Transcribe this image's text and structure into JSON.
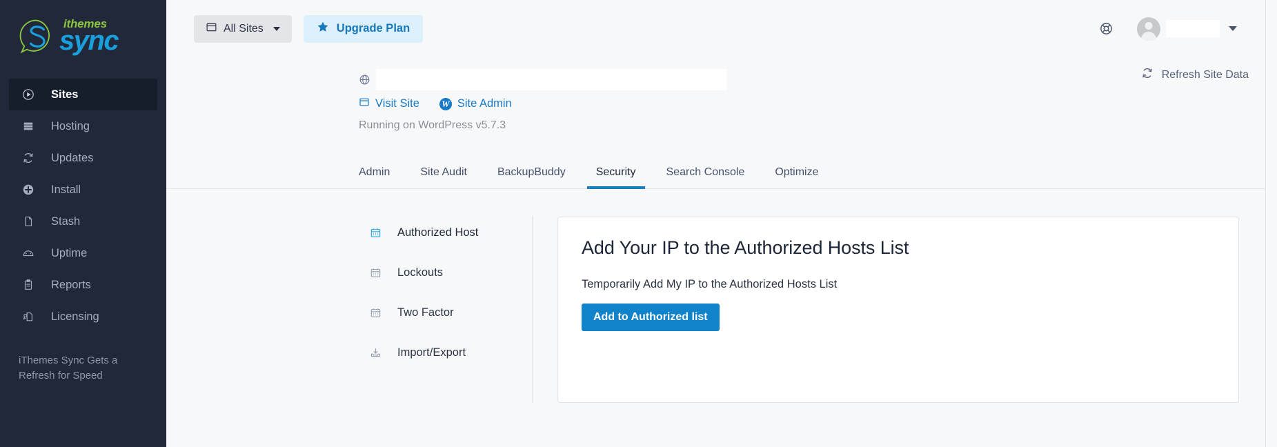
{
  "brand": {
    "name_top": "ithemes",
    "name_bottom": "sync",
    "green": "#8cc63e",
    "blue": "#1a9fdc"
  },
  "sidebar": {
    "items": [
      {
        "label": "Sites",
        "icon": "play-circle-icon",
        "active": true
      },
      {
        "label": "Hosting",
        "icon": "server-icon",
        "active": false
      },
      {
        "label": "Updates",
        "icon": "refresh-icon",
        "active": false
      },
      {
        "label": "Install",
        "icon": "plus-circle-icon",
        "active": false
      },
      {
        "label": "Stash",
        "icon": "file-icon",
        "active": false
      },
      {
        "label": "Uptime",
        "icon": "gauge-icon",
        "active": false
      },
      {
        "label": "Reports",
        "icon": "clipboard-icon",
        "active": false
      },
      {
        "label": "Licensing",
        "icon": "license-tag-icon",
        "active": false
      }
    ],
    "note": "iThemes Sync Gets a Refresh for Speed"
  },
  "topbar": {
    "sites_selector": "All Sites",
    "sites_icon": "window-icon",
    "upgrade_label": "Upgrade Plan",
    "upgrade_icon": "star-icon",
    "help_icon": "lifebuoy-icon",
    "avatar_icon": "avatar",
    "user_name": "",
    "user_caret_icon": "chevron-down-icon"
  },
  "site_header": {
    "globe_icon": "globe-icon",
    "site_name": "",
    "visit_site": "Visit Site",
    "visit_icon": "window-icon",
    "site_admin": "Site Admin",
    "site_admin_icon": "wordpress-icon",
    "version_text": "Running on WordPress v5.7.3",
    "refresh_label": "Refresh Site Data",
    "refresh_icon": "refresh-icon"
  },
  "tabs": [
    {
      "label": "Admin",
      "active": false
    },
    {
      "label": "Site Audit",
      "active": false
    },
    {
      "label": "BackupBuddy",
      "active": false
    },
    {
      "label": "Security",
      "active": true
    },
    {
      "label": "Search Console",
      "active": false
    },
    {
      "label": "Optimize",
      "active": false
    }
  ],
  "subnav": [
    {
      "label": "Authorized Host",
      "icon": "calendar-icon",
      "active": true
    },
    {
      "label": "Lockouts",
      "icon": "calendar-icon",
      "active": false
    },
    {
      "label": "Two Factor",
      "icon": "calendar-icon",
      "active": false
    },
    {
      "label": "Import/Export",
      "icon": "import-export-icon",
      "active": false
    }
  ],
  "card": {
    "title": "Add Your IP to the Authorized Hosts List",
    "description": "Temporarily Add My IP to the Authorized Hosts List",
    "button_label": "Add to Authorized list",
    "button_color": "#1083cb"
  },
  "highlight_color": "#2fabe4"
}
